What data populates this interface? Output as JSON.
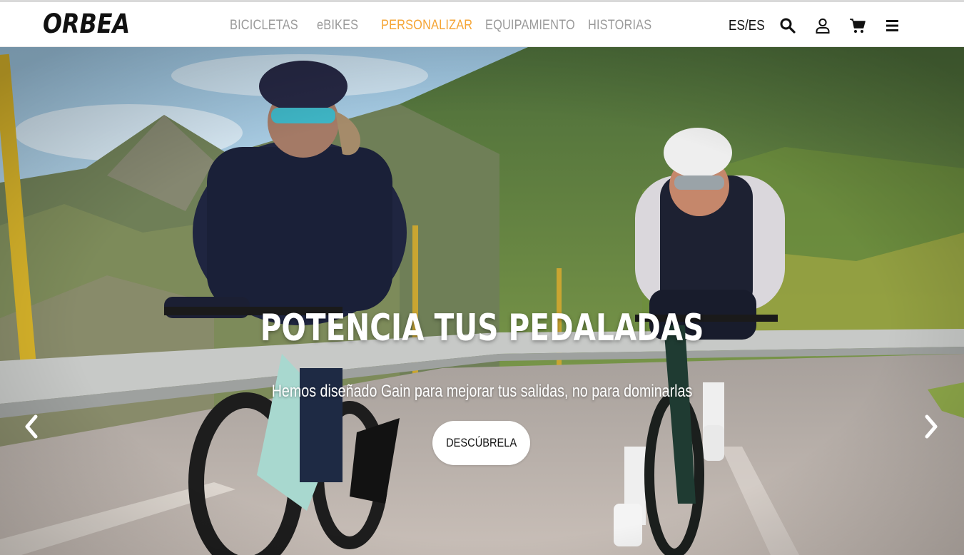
{
  "brand": {
    "logo": "ORBEA"
  },
  "nav": {
    "items": [
      {
        "label": "BICICLETAS",
        "active": false
      },
      {
        "label": "eBIKES",
        "active": false
      },
      {
        "label": "PERSONALIZAR",
        "active": true
      },
      {
        "label": "EQUIPAMIENTO",
        "active": false
      },
      {
        "label": "HISTORIAS",
        "active": false
      }
    ],
    "language": "ES/ES",
    "icons": [
      "search-icon",
      "user-icon",
      "cart-icon",
      "menu-icon"
    ],
    "active_color": "#f5a535",
    "inactive_color": "#9a9a9a"
  },
  "hero": {
    "title": "POTENCIA TUS PEDALADAS",
    "subtitle": "Hemos diseñado Gain para mejorar tus salidas, no para dominarlas",
    "cta_label": "DESCÚBRELA",
    "prev_icon": "chevron-left-icon",
    "next_icon": "chevron-right-icon"
  }
}
